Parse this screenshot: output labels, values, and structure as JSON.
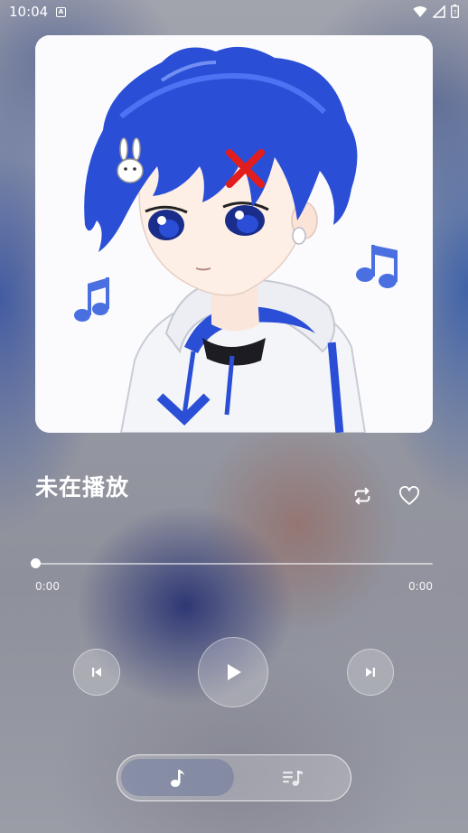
{
  "status_bar": {
    "time": "10:04",
    "notification_icon": "a-letter-icon",
    "icons": [
      "wifi-icon",
      "signal-icon",
      "battery-icon"
    ]
  },
  "album": {
    "art_icon": "anime-boy-illustration"
  },
  "player": {
    "title": "未在播放",
    "current_time": "0:00",
    "total_time": "0:00",
    "progress": 0
  },
  "controls": {
    "prev_icon": "skip-previous-icon",
    "play_icon": "play-icon",
    "next_icon": "skip-next-icon",
    "repeat_icon": "repeat-icon",
    "like_icon": "heart-outline-icon"
  },
  "nav": {
    "tabs": [
      {
        "icon": "music-note-icon",
        "active": true
      },
      {
        "icon": "playlist-icon",
        "active": false
      }
    ]
  },
  "colors": {
    "accent_blue": "#2a4fd6",
    "text": "#ffffff"
  }
}
